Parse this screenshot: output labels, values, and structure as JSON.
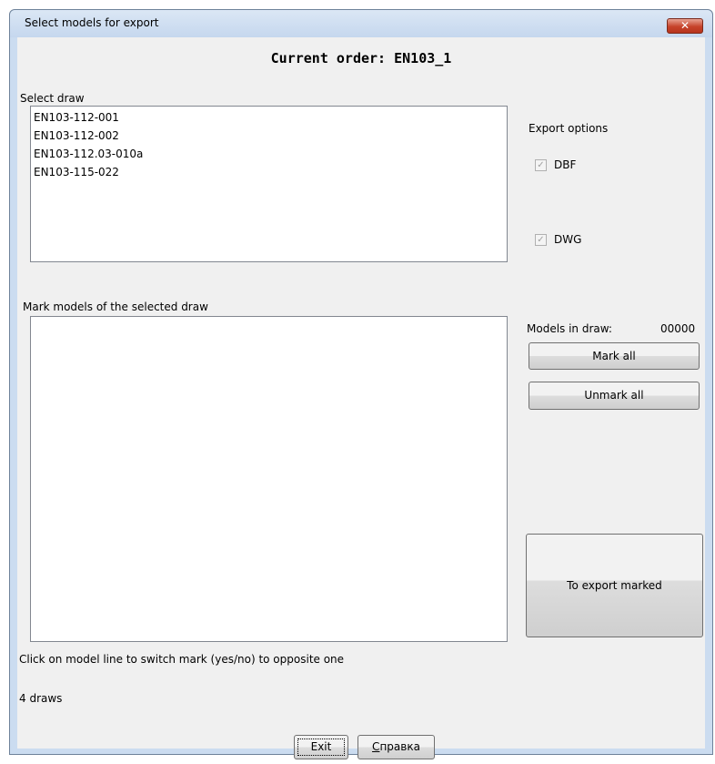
{
  "window": {
    "title": "Select models for export",
    "close_label": "✕"
  },
  "header": {
    "current_order": "Current order:  EN103_1"
  },
  "select_draw": {
    "label": "Select draw",
    "items": [
      "EN103-112-001",
      "EN103-112-002",
      "EN103-112.03-010a",
      "EN103-115-022"
    ]
  },
  "export_options": {
    "label": "Export options",
    "options": [
      {
        "label": "DBF",
        "checked": true
      },
      {
        "label": "DWG",
        "checked": true
      }
    ]
  },
  "mark_models": {
    "label": "Mark models of the selected draw",
    "items": []
  },
  "models_in_draw": {
    "label": "Models in draw:",
    "value": "00000"
  },
  "buttons": {
    "mark_all": "Mark all",
    "unmark_all": "Unmark all",
    "export_marked": "To export marked",
    "exit": "Exit",
    "help": "Справка",
    "help_mnemonic": "С",
    "help_rest": "правка"
  },
  "hint": "Click on model line to switch mark (yes/no) to opposite one",
  "status": "4 draws"
}
